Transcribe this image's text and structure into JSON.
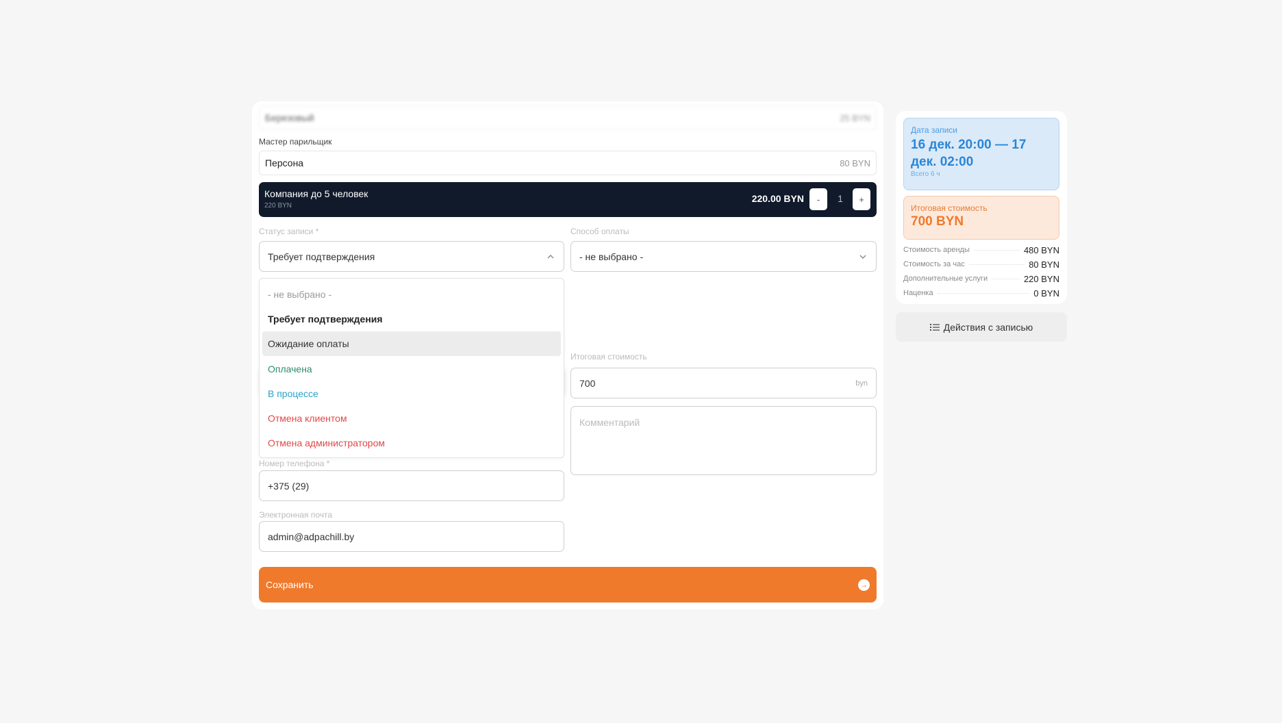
{
  "services": {
    "top_item": {
      "name": "Березовый",
      "price": "25 BYN"
    },
    "master_label": "Мастер парильщик",
    "master_item": {
      "name": "Персона",
      "price": "80 BYN"
    },
    "company": {
      "name": "Компания до 5 человек",
      "sub_price": "220 BYN",
      "total": "220.00 BYN",
      "minus": "-",
      "qty": "1",
      "plus": "+"
    }
  },
  "status": {
    "label": "Статус записи *",
    "value": "Требует подтверждения",
    "options": [
      {
        "label": "- не выбрано -",
        "color": "#9a9a9a",
        "weight": "normal"
      },
      {
        "label": "Требует подтверждения",
        "color": "#222222",
        "weight": "bold"
      },
      {
        "label": "Ожидание оплаты",
        "color": "#333333",
        "weight": "normal"
      },
      {
        "label": "Оплачена",
        "color": "#2e8a6a",
        "weight": "normal"
      },
      {
        "label": "В процессе",
        "color": "#2aa3c7",
        "weight": "normal"
      },
      {
        "label": "Отмена клиентом",
        "color": "#e04848",
        "weight": "normal"
      },
      {
        "label": "Отмена администратором",
        "color": "#e04848",
        "weight": "normal"
      }
    ]
  },
  "payment": {
    "label": "Способ оплаты",
    "value": "- не выбрано -"
  },
  "total_cost": {
    "label": "Итоговая стоимость",
    "value": "700",
    "unit": "byn"
  },
  "comment": {
    "placeholder": "Комментарий"
  },
  "phone": {
    "label": "Номер телефона *",
    "value": "+375 (29)"
  },
  "email": {
    "label": "Электронная почта",
    "value": "admin@adpachill.by"
  },
  "save_label": "Сохранить",
  "sidebar": {
    "date_title": "Дата записи",
    "date_value": "16 дек. 20:00 — 17 дек. 02:00",
    "date_sub": "Всего 6 ч",
    "cost_title": "Итоговая стоимость",
    "cost_value": "700 BYN",
    "breakdown": [
      {
        "k": "Стоимость аренды",
        "v": "480 BYN"
      },
      {
        "k": "Стоимость за час",
        "v": "80 BYN"
      },
      {
        "k": "Дополнительные услуги",
        "v": "220 BYN"
      },
      {
        "k": "Наценка",
        "v": "0 BYN"
      }
    ],
    "actions_label": "Действия с записью"
  },
  "colors": {
    "accent": "#ef7a2c",
    "dark": "#111a2b",
    "blue": "#2a86d6"
  }
}
